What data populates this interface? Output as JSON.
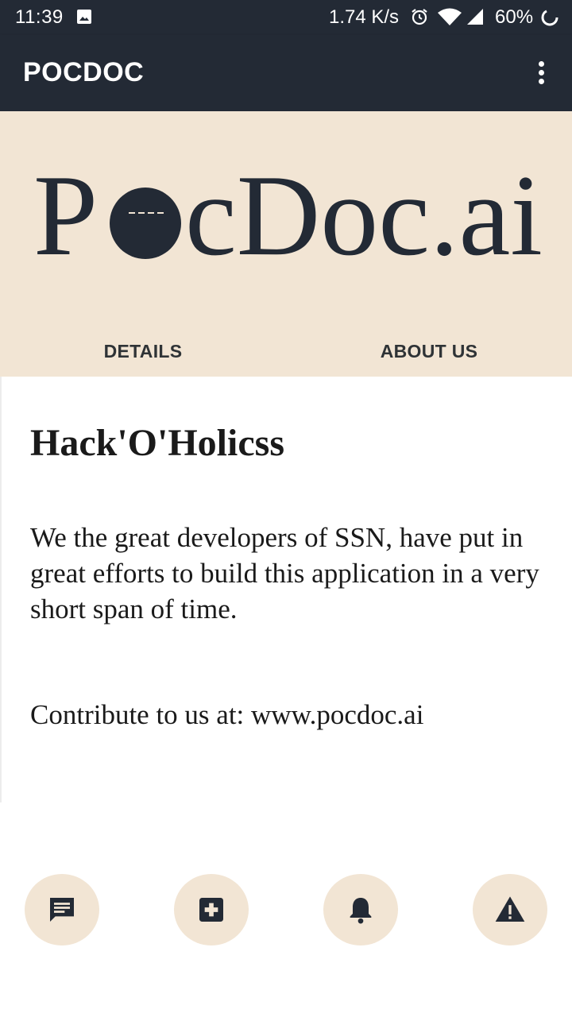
{
  "status_bar": {
    "time": "11:39",
    "net_speed": "1.74 K/s",
    "battery": "60%",
    "icons": [
      "gallery-icon",
      "alarm-icon",
      "wifi-icon",
      "signal-icon",
      "battery-icon"
    ]
  },
  "app_bar": {
    "title": "POCDOC",
    "menu_icon": "more-vert-icon"
  },
  "logo": {
    "text": "PocDoc.ai"
  },
  "tabs": [
    {
      "label": "DETAILS"
    },
    {
      "label": "ABOUT US"
    }
  ],
  "about": {
    "title": "Hack'O'Holicss",
    "body": "We the great developers of SSN, have put in great efforts to build this application in a very short span of time.",
    "contribute": "Contribute to us at: www.pocdoc.ai"
  },
  "bottom_actions": [
    {
      "icon": "chat-icon"
    },
    {
      "icon": "medical-cross-icon"
    },
    {
      "icon": "bell-icon"
    },
    {
      "icon": "warning-icon"
    }
  ],
  "colors": {
    "dark": "#232a35",
    "beige": "#f2e5d4",
    "text": "#1a1a1a"
  }
}
